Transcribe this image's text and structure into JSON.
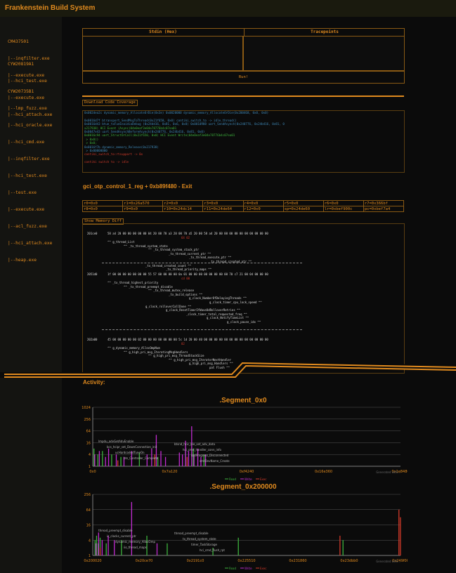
{
  "app": {
    "title": "Frankenstein Build System"
  },
  "sidebar": [
    {
      "name": "CM437501",
      "files": [
        "|--inqfilter.exe",
        "|--execute.exe"
      ]
    },
    {
      "name": "CYW20819A1",
      "files": [
        "|--hci_test.exe",
        "|--execute.exe",
        "|--hci_attach.exe"
      ]
    },
    {
      "name": "CYW20735B1",
      "files": [
        "|--lmp_fuzz.exe",
        "|--hci_oracle.exe",
        "|--hci_cmd.exe",
        "|--inqfilter.exe",
        "|--hci_test.exe",
        "|--test.exe",
        "|--execute.exe",
        "|--acl_fuzz.exe",
        "|--hci_attach.exe",
        "|--heap.exe"
      ]
    }
  ],
  "io": {
    "stdin_header": "Stdin (Hex)",
    "trace_header": "Tracepoints",
    "run_label": "Run!"
  },
  "coverage_button": "Download Code Coverage",
  "console": [
    {
      "c": "cyan",
      "t": "0x002dea2c dynamic_memory_AllocateOrDie(0x3e) 0x0020000 dynamic_memory_AllocateOrDie(0x200468, 0x0, 0x0)"
    },
    {
      "c": "green",
      "t": ""
    },
    {
      "c": "cyan",
      "t": "0x0016d7f btransport_SendMsgToThread(0x21f650, 0x0) contiki_switch_to -> idle_thread()"
    },
    {
      "c": "cyan",
      "t": "0x0016d43 btue_txFunEnaidiaDebug (0x24dd16, 0x81, 0x6, 0x0) 0x0010988 uart_SendAsynch(0x240776, 0x24b416, 0x81, 0"
    },
    {
      "c": "green",
      "t": "x217938) HCI Event (Async)04e0eaf3e04e78776b4c07ea01"
    },
    {
      "c": "cyan",
      "t": "0x0047e43 uart_SendAsynchBeforeAsynch(0x240776, 0x24b416, 0x81, 0x0)"
    },
    {
      "c": "green",
      "t": "0x0016c94 uart_StructOrCall(0x21f650, 0x0) HCI Event Write(04e0eaf3e04e78776b4c07ea01"
    },
    {
      "c": "green",
      "t": " > 0x0()"
    },
    {
      "c": "green",
      "t": " > 0x0;"
    },
    {
      "c": "cyan",
      "t": "0x0016f7b dynamic_memory_Release(0x217938)"
    },
    {
      "c": "cyan",
      "t": " > 0x00000000"
    },
    {
      "c": "red",
      "t": "contiki_switch_to:rtsupport -> 0x"
    },
    {
      "c": "green",
      "t": ""
    },
    {
      "c": "red",
      "t": "contiki switch to -> idle"
    }
  ],
  "exit_line": "gci_otp_control_1_reg + 0xb89f480 - Exit",
  "registers": [
    [
      "r0=0x0",
      "r1=0x26a570",
      "r2=0x0",
      "r3=0x0",
      "r4=0x0",
      "r5=0x0",
      "r6=0x0",
      "r7=0x366bf"
    ],
    [
      "r8=0x0",
      "r9=0x0",
      "r10=0x24dc14",
      "r11=0x24de64",
      "r12=0x0",
      "sp=0x24de60",
      "lr=0xbef900c",
      "pc=0xbef7a4"
    ]
  ],
  "memdiff_button": "Show Memory Diff",
  "memdiff": {
    "rows": [
      {
        "addr": "201ce0",
        "hex": "58 a4 20 00 00 00 00 00 04 20 00 70 a3 20 00 70 a5 20 00 58 a4 20 00 00 00 00 00 00 00 00 00 00"
      },
      {
        "addr": "2051d0",
        "hex": "1f 00 00 00 00 00 00 00 55 57 00 00 00 00 0a 01 00 00 00 00 00 00 00 00 70 c7 21 00 04 00 00 00"
      },
      {
        "addr": "202a00",
        "hex": "45 00 00 00 00 00 02 00 00 00 00 00 00 00 5c 1d 20 00 40 00 00 00 00 00 00 00 00 00 00 00 00 00"
      }
    ],
    "changes": [
      "64 02",
      "cd 00",
      "02"
    ],
    "labels1": [
      "^^ g_thread_List",
      "^^ _tx_thread_system_state",
      "^^ _tx_thread_system_stack_ptr",
      "_tx_thread_current_ptr ^^",
      "_tx_thread_execute_ptr ^^",
      "_tx_thread_created_ptr ^^",
      "_tx_thread_created_count ^^",
      "_tx_thread_priority_maps ^^"
    ],
    "labels2": [
      "^^ _tx_thread_highest_priority",
      "^^ _tx_thread_preempt_disable",
      "^^ _tx_thread_mutex_release",
      "_tx_build_options ^^",
      "g_clock_NumberOfDelayingThreads ^^",
      "g_clock_timer_cpu_lock_speed ^^",
      "g_clock_rolloverCallDone ^^",
      "g_clock_ResetTimerIfWaveOdRolloverRetries ^^",
      "_clock_timer_total_requested_freq ^^",
      "g_clock_NotifyTimeList ^^",
      "g_clock_pause_idx ^^"
    ],
    "labels3": [
      "^^ g_dynamic_memory_AllocOmpNum",
      "^^ g_high_pri_msg_IteratingMsgHandlers",
      "^^ g_high_pri_msg_ThreadStackSize",
      "^^ g_high_pri_msg_IteratorNextHandler",
      "g_high_pri_msg_Handlers ^^",
      "pat Flush ^^"
    ]
  },
  "activity_label": "Activity:",
  "chart_data": [
    {
      "type": "bar",
      "title": ".Segment_0x0",
      "xticks": [
        "0x0",
        "0x7a120",
        "0xf4240",
        "0x16e360",
        "0x1e8480"
      ],
      "xlim": [
        0,
        2000000
      ],
      "ylim": [
        1,
        1024
      ],
      "yscale": "log",
      "yticks": [
        "1024",
        "256",
        "64",
        "16",
        "4",
        "1"
      ],
      "grid": true,
      "series": [
        {
          "name": "Read",
          "color": "#3db23d",
          "values": [
            [
              5000,
              8
            ],
            [
              30000,
              4
            ],
            [
              60000,
              6
            ],
            [
              120000,
              4
            ],
            [
              180000,
              3
            ],
            [
              300000,
              5
            ],
            [
              420000,
              3
            ],
            [
              600000,
              6
            ],
            [
              650000,
              8
            ],
            [
              720000,
              4
            ]
          ]
        },
        {
          "name": "Write",
          "color": "#c12bd1",
          "values": [
            [
              10000,
              4
            ],
            [
              40000,
              6
            ],
            [
              80000,
              3
            ],
            [
              100000,
              8
            ],
            [
              150000,
              4
            ],
            [
              200000,
              3
            ],
            [
              250000,
              6
            ],
            [
              350000,
              4
            ],
            [
              380000,
              8
            ],
            [
              410000,
              40
            ],
            [
              440000,
              6
            ],
            [
              470000,
              3
            ],
            [
              560000,
              5
            ],
            [
              580000,
              4
            ],
            [
              600000,
              20
            ],
            [
              620000,
              6
            ],
            [
              640000,
              110
            ],
            [
              655000,
              4
            ],
            [
              680000,
              8
            ],
            [
              700000,
              3
            ],
            [
              730000,
              4
            ]
          ]
        },
        {
          "name": "Exec",
          "color": "#d23a2a",
          "values": [
            [
              160000,
              2
            ],
            [
              400000,
              4
            ],
            [
              610000,
              3
            ]
          ]
        }
      ],
      "annotations": [
        "lmpdu_advGetAdvEnable",
        "btsnd_hcic_ble_set_adv_data",
        "bcs_hcipr_set_DownConnection_init",
        "hci_cmd_handler_conn_info",
        "ucHardcodedTuneOn",
        "lcidProgress_Disconnected",
        "bts_Controller_Complete",
        "smtDevName_Create"
      ],
      "legend": [
        "Read",
        "Write",
        "Exec"
      ],
      "watermark": "Generated with..."
    },
    {
      "type": "bar",
      "title": ".Segment_0x200000",
      "xticks": [
        "0x200020",
        "0x20ce70",
        "0x2191c0",
        "0x225510",
        "0x231860",
        "0x23dbb0",
        "0x249f00"
      ],
      "xlim": [
        2097184,
        2400000
      ],
      "ylim": [
        1,
        256
      ],
      "yscale": "log",
      "yticks": [
        "256",
        "64",
        "16",
        "4",
        "1"
      ],
      "grid": true,
      "series": [
        {
          "name": "Read",
          "color": "#3db23d",
          "values": [
            [
              2099000,
              4
            ],
            [
              2100500,
              6
            ],
            [
              2102000,
              3
            ],
            [
              2104000,
              5
            ],
            [
              2110000,
              3
            ],
            [
              2125000,
              4
            ],
            [
              2150000,
              6
            ],
            [
              2170000,
              3
            ],
            [
              2215000,
              2
            ],
            [
              2240000,
              5
            ],
            [
              2343000,
              4
            ]
          ]
        },
        {
          "name": "Write",
          "color": "#c12bd1",
          "values": [
            [
              2100000,
              3
            ],
            [
              2102500,
              8
            ],
            [
              2106000,
              4
            ],
            [
              2112000,
              6
            ],
            [
              2118000,
              4
            ],
            [
              2135000,
              128
            ],
            [
              2160000,
              3
            ]
          ]
        },
        {
          "name": "Exec",
          "color": "#d23a2a",
          "values": [
            [
              2104000,
              2
            ],
            [
              2340000,
              6
            ],
            [
              2398000,
              64
            ],
            [
              2399500,
              32
            ]
          ]
        }
      ],
      "annotations": [
        "thread_preempt_disable",
        "thread_preempt_disable",
        "ic_clocks_current_ptr",
        "tx_thread_system_state",
        "dynamic_memory_AllocOmp",
        "timer_TaskStorage",
        "iio_thread_maps",
        "hci_cmd_flush_rpt"
      ],
      "legend": [
        "Read",
        "Write",
        "Exec"
      ],
      "watermark": "Generated with..."
    }
  ]
}
